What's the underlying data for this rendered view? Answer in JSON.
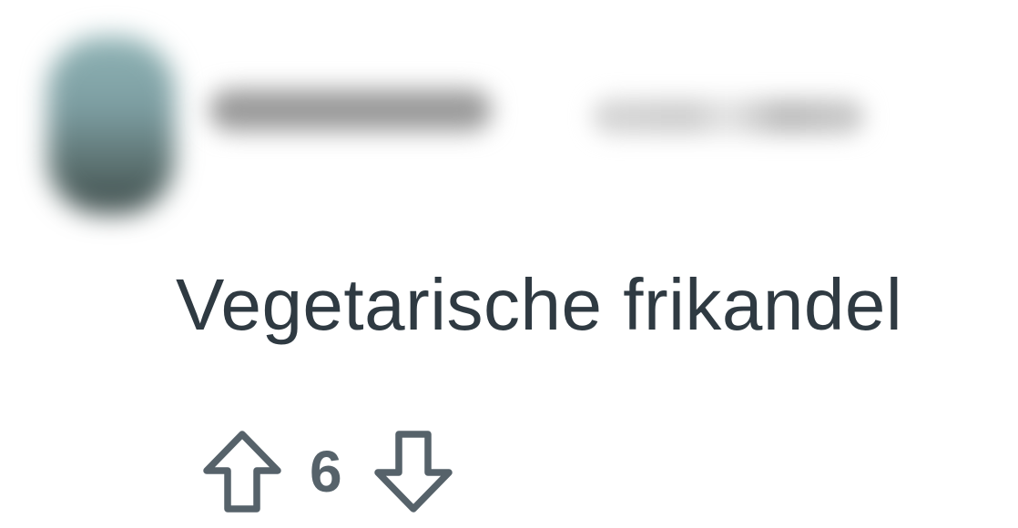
{
  "comment": {
    "author": {
      "avatar": "blurred-user-avatar",
      "username": "",
      "timestamp": ""
    },
    "body": "Vegetarische frikandel",
    "votes": {
      "score": "6",
      "upvote_icon": "arrow-up-outline-icon",
      "downvote_icon": "arrow-down-outline-icon"
    }
  },
  "colors": {
    "text": "#2f3a42",
    "icon": "#56626a",
    "background": "#ffffff"
  }
}
